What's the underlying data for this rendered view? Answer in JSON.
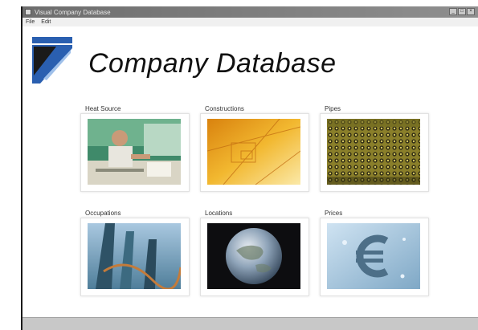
{
  "window": {
    "title": "Visual Company Database",
    "buttons": [
      "_",
      "□",
      "×"
    ]
  },
  "menu": {
    "items": [
      "File",
      "Edit"
    ]
  },
  "header": {
    "title": "Company Database"
  },
  "tiles": [
    {
      "label": "Heat Source",
      "icon": "engineer-photo"
    },
    {
      "label": "Constructions",
      "icon": "blueprint-photo"
    },
    {
      "label": "Pipes",
      "icon": "pipes-photo"
    },
    {
      "label": "Occupations",
      "icon": "city-photo"
    },
    {
      "label": "Locations",
      "icon": "earth-photo"
    },
    {
      "label": "Prices",
      "icon": "euro-photo"
    }
  ],
  "colors": {
    "titlebar": "#7a7a7a",
    "logo_blue": "#2a5fb0",
    "logo_dark": "#1a1a1a"
  }
}
